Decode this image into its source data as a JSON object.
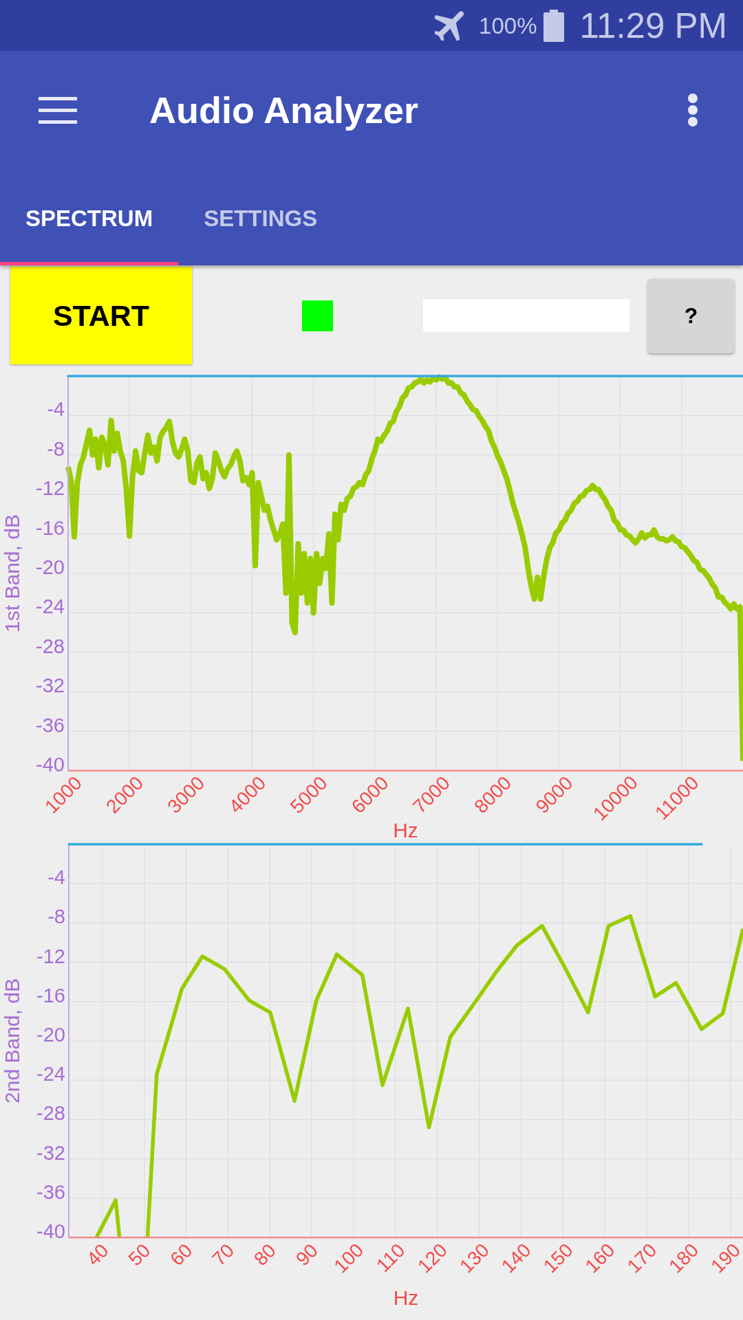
{
  "status_bar": {
    "battery": "100%",
    "time": "11:29 PM"
  },
  "toolbar": {
    "title": "Audio Analyzer"
  },
  "tabs": [
    {
      "label": "SPECTRUM",
      "selected": true
    },
    {
      "label": "SETTINGS",
      "selected": false
    }
  ],
  "controls": {
    "start_button": "START",
    "status_indicator": {
      "color": "#00ff00"
    },
    "help_button": "?"
  },
  "charts": [
    {
      "chart_data": {
        "type": "line",
        "xlabel": "Hz",
        "ylabel": "1st Band, dB",
        "xlim": [
          1000,
          12000
        ],
        "ylim": [
          -40,
          0
        ],
        "xticks": [
          1000,
          2000,
          3000,
          4000,
          5000,
          6000,
          7000,
          8000,
          9000,
          10000,
          11000
        ],
        "yticks": [
          -4,
          -8,
          -12,
          -16,
          -20,
          -24,
          -28,
          -32,
          -36,
          -40
        ],
        "grid": true,
        "x": [
          1000,
          1050,
          1100,
          1150,
          1200,
          1250,
          1300,
          1350,
          1400,
          1450,
          1500,
          1550,
          1600,
          1650,
          1700,
          1750,
          1800,
          1850,
          1900,
          1950,
          2000,
          2050,
          2100,
          2150,
          2200,
          2250,
          2300,
          2350,
          2400,
          2450,
          2500,
          2550,
          2600,
          2650,
          2700,
          2750,
          2800,
          2850,
          2900,
          2950,
          3000,
          3050,
          3100,
          3150,
          3200,
          3250,
          3300,
          3350,
          3400,
          3450,
          3500,
          3550,
          3600,
          3650,
          3700,
          3750,
          3800,
          3850,
          3900,
          3950,
          4000,
          4050,
          4100,
          4150,
          4200,
          4250,
          4300,
          4350,
          4400,
          4450,
          4500,
          4550,
          4600,
          4650,
          4700,
          4750,
          4800,
          4850,
          4900,
          4950,
          5000,
          5050,
          5100,
          5150,
          5200,
          5250,
          5300,
          5350,
          5400,
          5450,
          5500,
          5550,
          5600,
          5650,
          5700,
          5750,
          5800,
          5850,
          5900,
          5950,
          6000,
          6050,
          6100,
          6150,
          6200,
          6250,
          6300,
          6350,
          6400,
          6450,
          6500,
          6550,
          6600,
          6650,
          6700,
          6750,
          6800,
          6850,
          6900,
          6950,
          7000,
          7050,
          7100,
          7150,
          7200,
          7250,
          7300,
          7350,
          7400,
          7450,
          7500,
          7550,
          7600,
          7650,
          7700,
          7750,
          7800,
          7850,
          7900,
          7950,
          8000,
          8050,
          8100,
          8150,
          8200,
          8250,
          8300,
          8350,
          8400,
          8450,
          8500,
          8550,
          8600,
          8650,
          8700,
          8750,
          8800,
          8850,
          8900,
          8950,
          9000,
          9050,
          9100,
          9150,
          9200,
          9250,
          9300,
          9350,
          9400,
          9450,
          9500,
          9550,
          9600,
          9650,
          9700,
          9750,
          9800,
          9850,
          9900,
          9950,
          10000,
          10050,
          10100,
          10150,
          10200,
          10250,
          10300,
          10350,
          10400,
          10450,
          10500,
          10550,
          10600,
          10650,
          10700,
          10750,
          10800,
          10850,
          10900,
          10950,
          11000,
          11050,
          11100,
          11150,
          11200,
          11250,
          11300,
          11350,
          11400,
          11450,
          11500,
          11550,
          11600,
          11650,
          11700,
          11750,
          11800,
          11850,
          11900,
          11950,
          12000
        ],
        "series": [
          {
            "color": "#99cc00",
            "values": [
              -9.2,
              -10.6,
              -16.3,
              -10.8,
              -9.0,
              -8.2,
              -6.8,
              -5.5,
              -8.0,
              -6.4,
              -9.3,
              -6.2,
              -7.0,
              -9.0,
              -4.5,
              -7.6,
              -5.8,
              -7.6,
              -8.6,
              -11.6,
              -16.2,
              -10.2,
              -7.6,
              -9.6,
              -9.8,
              -7.8,
              -6.0,
              -7.8,
              -7.2,
              -8.6,
              -6.2,
              -5.6,
              -5.2,
              -4.6,
              -6.6,
              -7.8,
              -8.2,
              -7.4,
              -6.4,
              -7.6,
              -10.6,
              -10.8,
              -8.8,
              -8.2,
              -10.4,
              -9.8,
              -11.4,
              -10.4,
              -7.8,
              -8.6,
              -9.6,
              -10.2,
              -9.4,
              -9.0,
              -8.2,
              -7.6,
              -8.6,
              -10.6,
              -10.3,
              -11.0,
              -9.8,
              -19.2,
              -10.8,
              -12.2,
              -13.6,
              -13.2,
              -14.6,
              -15.6,
              -16.6,
              -16.0,
              -15.0,
              -22.0,
              -8.0,
              -25.0,
              -26.0,
              -17.0,
              -22.0,
              -18.0,
              -23.0,
              -18.5,
              -24.0,
              -18.0,
              -21.0,
              -18.5,
              -19.5,
              -16.0,
              -23.0,
              -14.0,
              -16.6,
              -13.0,
              -13.6,
              -12.4,
              -12.2,
              -11.4,
              -11.2,
              -10.8,
              -11.0,
              -10.0,
              -9.6,
              -8.4,
              -7.6,
              -6.4,
              -6.6,
              -6.0,
              -5.6,
              -4.8,
              -4.6,
              -3.6,
              -3.1,
              -2.2,
              -1.9,
              -1.2,
              -1.1,
              -0.7,
              -0.6,
              -0.3,
              -0.7,
              -0.4,
              -0.6,
              -0.2,
              -0.4,
              -0.1,
              -0.3,
              -0.2,
              -0.7,
              -0.7,
              -1.1,
              -1.1,
              -1.7,
              -1.9,
              -2.5,
              -2.9,
              -3.4,
              -3.5,
              -4.1,
              -4.5,
              -5.1,
              -5.5,
              -6.6,
              -7.2,
              -8.1,
              -8.7,
              -9.6,
              -10.4,
              -11.6,
              -12.9,
              -13.9,
              -14.9,
              -16.1,
              -17.4,
              -19.6,
              -21.4,
              -22.6,
              -20.4,
              -22.6,
              -20.4,
              -18.6,
              -17.4,
              -16.9,
              -15.9,
              -15.6,
              -14.9,
              -14.6,
              -13.9,
              -13.6,
              -12.9,
              -12.7,
              -12.2,
              -12.1,
              -11.6,
              -11.5,
              -11.1,
              -11.5,
              -11.5,
              -12.1,
              -12.5,
              -13.2,
              -13.6,
              -14.6,
              -14.9,
              -15.6,
              -15.6,
              -16.1,
              -16.2,
              -16.6,
              -16.9,
              -16.5,
              -15.9,
              -16.4,
              -16.1,
              -16.1,
              -15.6,
              -16.3,
              -16.5,
              -16.5,
              -16.7,
              -16.6,
              -16.3,
              -16.7,
              -16.8,
              -17.3,
              -17.4,
              -17.8,
              -18.2,
              -18.7,
              -18.9,
              -19.6,
              -19.7,
              -20.1,
              -20.5,
              -21.1,
              -21.5,
              -22.4,
              -22.4,
              -22.9,
              -23.2,
              -23.6,
              -23.1,
              -23.6,
              -23.4,
              -39.0
            ]
          }
        ]
      }
    },
    {
      "chart_data": {
        "type": "line",
        "xlabel": "Hz",
        "ylabel": "2nd Band, dB",
        "xlim": [
          32,
          193
        ],
        "ylim": [
          -40,
          0
        ],
        "xticks": [
          40,
          50,
          60,
          70,
          80,
          90,
          100,
          110,
          120,
          130,
          140,
          150,
          160,
          170,
          180,
          190
        ],
        "yticks": [
          -4,
          -8,
          -12,
          -16,
          -20,
          -24,
          -28,
          -32,
          -36,
          -40
        ],
        "grid": true,
        "x": [
          38.6,
          43.2,
          44.1,
          50.8,
          53.0,
          59.0,
          63.9,
          69.2,
          75.1,
          80.1,
          85.9,
          91.1,
          96.0,
          102.1,
          106.9,
          113.0,
          118.0,
          123.1,
          129.3,
          134.2,
          139.0,
          145.0,
          150.4,
          156.0,
          160.9,
          166.1,
          172.0,
          177.0,
          183.1,
          188.2,
          193.0
        ],
        "series": [
          {
            "color": "#99cc00",
            "values": [
              -40,
              -36.2,
              -40,
              -40,
              -23.4,
              -14.7,
              -11.4,
              -12.7,
              -15.9,
              -17.1,
              -26.1,
              -15.9,
              -11.2,
              -13.3,
              -24.5,
              -16.7,
              -28.8,
              -19.6,
              -15.9,
              -12.9,
              -10.3,
              -8.3,
              -12.5,
              -17.1,
              -8.3,
              -7.3,
              -15.5,
              -14.1,
              -18.8,
              -17.2,
              -8.6
            ]
          }
        ]
      }
    }
  ]
}
